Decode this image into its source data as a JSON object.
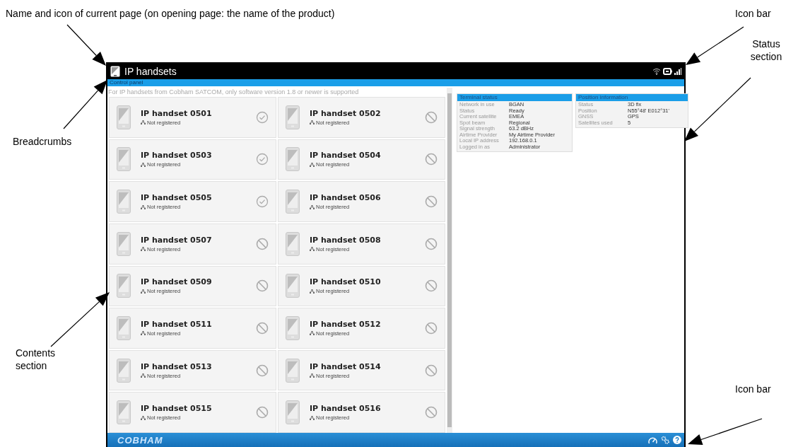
{
  "callouts": {
    "page_name": "Name and icon of current page (on opening page: the name of the product)",
    "icon_bar_top": "Icon bar",
    "status_section": "Status section",
    "breadcrumbs": "Breadcrumbs",
    "contents_section": "Contents section",
    "icon_bar_bottom": "Icon bar"
  },
  "screen": {
    "title": "IP handsets",
    "breadcrumb": "Control panel",
    "notice": "For IP handsets from Cobham SATCOM, only software version 1.8 or newer is supported",
    "handsets": [
      {
        "name": "IP handset 0501",
        "status": "Not registered",
        "kind": "check"
      },
      {
        "name": "IP handset 0502",
        "status": "Not registered",
        "kind": "blocked"
      },
      {
        "name": "IP handset 0503",
        "status": "Not registered",
        "kind": "check"
      },
      {
        "name": "IP handset 0504",
        "status": "Not registered",
        "kind": "blocked"
      },
      {
        "name": "IP handset 0505",
        "status": "Not registered",
        "kind": "check"
      },
      {
        "name": "IP handset 0506",
        "status": "Not registered",
        "kind": "blocked"
      },
      {
        "name": "IP handset 0507",
        "status": "Not registered",
        "kind": "blocked"
      },
      {
        "name": "IP handset 0508",
        "status": "Not registered",
        "kind": "blocked"
      },
      {
        "name": "IP handset 0509",
        "status": "Not registered",
        "kind": "blocked"
      },
      {
        "name": "IP handset 0510",
        "status": "Not registered",
        "kind": "blocked"
      },
      {
        "name": "IP handset 0511",
        "status": "Not registered",
        "kind": "blocked"
      },
      {
        "name": "IP handset 0512",
        "status": "Not registered",
        "kind": "blocked"
      },
      {
        "name": "IP handset 0513",
        "status": "Not registered",
        "kind": "blocked"
      },
      {
        "name": "IP handset 0514",
        "status": "Not registered",
        "kind": "blocked"
      },
      {
        "name": "IP handset 0515",
        "status": "Not registered",
        "kind": "blocked"
      },
      {
        "name": "IP handset 0516",
        "status": "Not registered",
        "kind": "blocked"
      }
    ],
    "terminal_status": {
      "title": "Terminal status",
      "rows": [
        {
          "label": "Network in use",
          "value": "BGAN"
        },
        {
          "label": "Status",
          "value": "Ready"
        },
        {
          "label": "Current satellite",
          "value": "EMEA"
        },
        {
          "label": "Spot beam",
          "value": "Regional"
        },
        {
          "label": "Signal strength",
          "value": "63.2 dBHz"
        },
        {
          "label": "Airtime Provider",
          "value": "My Airtime Provider"
        },
        {
          "label": "Local IP address",
          "value": "192.168.0.1"
        },
        {
          "label": "Logged in as",
          "value": "Administrator"
        }
      ]
    },
    "position_information": {
      "title": "Position information",
      "rows": [
        {
          "label": "Status",
          "value": "3D fix"
        },
        {
          "label": "Position",
          "value": "N55°48' E012°31'"
        },
        {
          "label": "GNSS",
          "value": "GPS"
        },
        {
          "label": "Satellites used",
          "value": "5"
        }
      ]
    },
    "logo": "COBHAM"
  }
}
